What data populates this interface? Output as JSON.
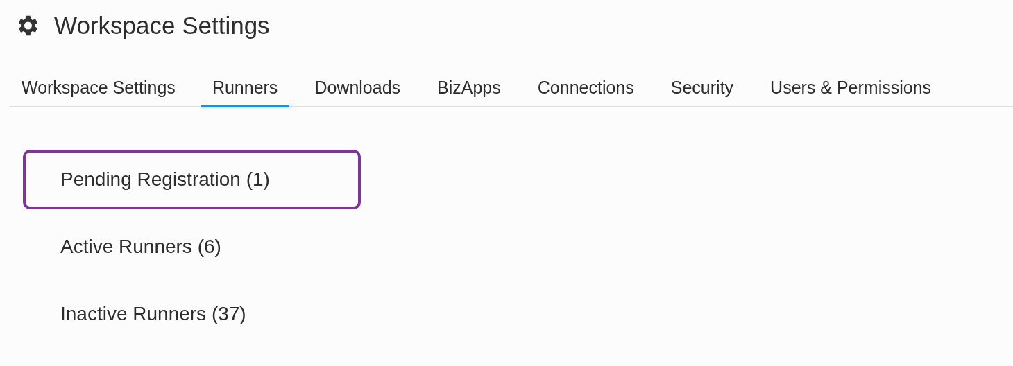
{
  "header": {
    "title": "Workspace Settings"
  },
  "tabs": [
    {
      "label": "Workspace Settings",
      "selected": false
    },
    {
      "label": "Runners",
      "selected": true
    },
    {
      "label": "Downloads",
      "selected": false
    },
    {
      "label": "BizApps",
      "selected": false
    },
    {
      "label": "Connections",
      "selected": false
    },
    {
      "label": "Security",
      "selected": false
    },
    {
      "label": "Users & Permissions",
      "selected": false
    }
  ],
  "runner_groups": [
    {
      "label": "Pending Registration (1)",
      "selected": true
    },
    {
      "label": "Active Runners (6)",
      "selected": false
    },
    {
      "label": "Inactive Runners (37)",
      "selected": false
    }
  ]
}
